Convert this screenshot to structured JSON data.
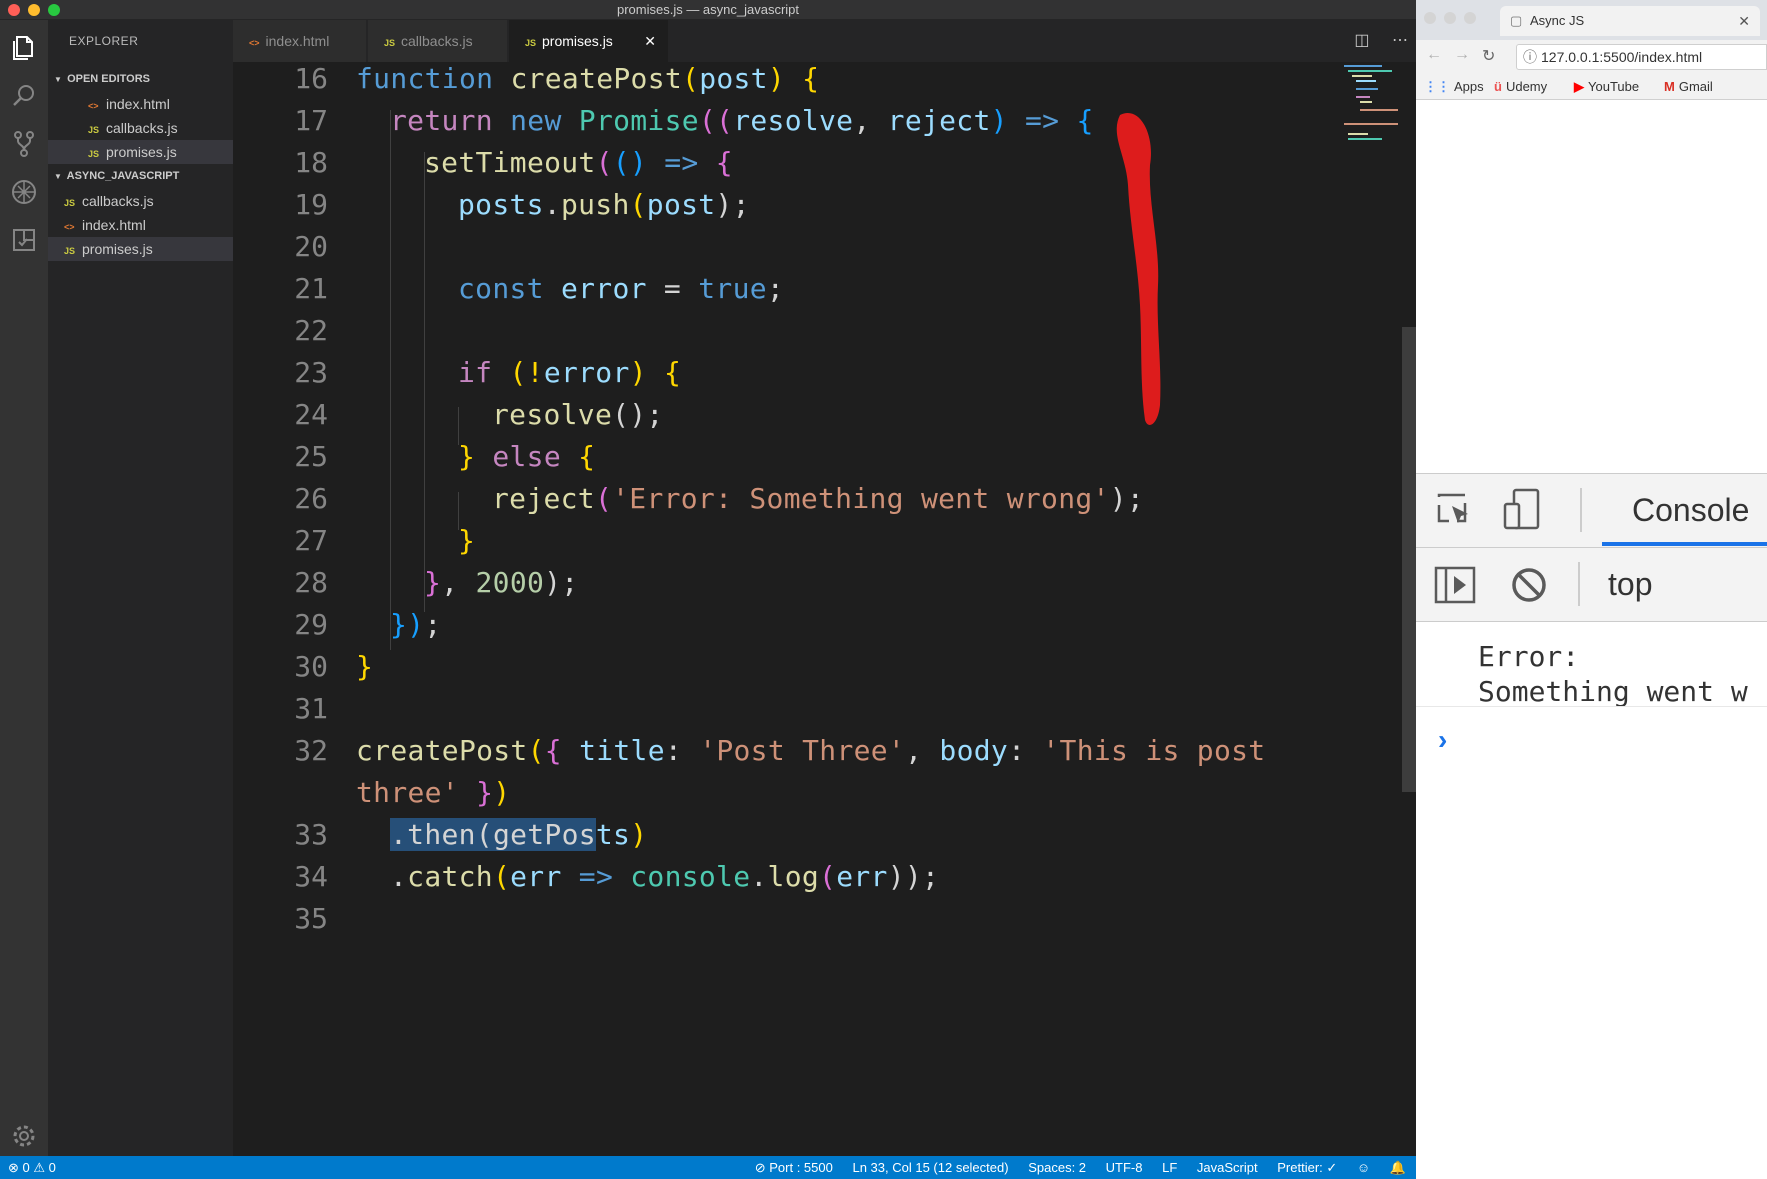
{
  "window_title": "promises.js — async_javascript",
  "sidebar": {
    "title": "EXPLORER",
    "open_editors_label": "OPEN EDITORS",
    "open_editors": [
      {
        "icon": "html",
        "label": "index.html"
      },
      {
        "icon": "js",
        "label": "callbacks.js"
      },
      {
        "icon": "js",
        "label": "promises.js"
      }
    ],
    "folder_label": "ASYNC_JAVASCRIPT",
    "folder_files": [
      {
        "icon": "js",
        "label": "callbacks.js"
      },
      {
        "icon": "html",
        "label": "index.html"
      },
      {
        "icon": "js",
        "label": "promises.js"
      }
    ]
  },
  "tabs": [
    {
      "icon": "html",
      "label": "index.html",
      "active": false
    },
    {
      "icon": "js",
      "label": "callbacks.js",
      "active": false
    },
    {
      "icon": "js",
      "label": "promises.js",
      "active": true
    }
  ],
  "icon_text": {
    "js": "JS",
    "html": "<>",
    "close": "✕"
  },
  "editor": {
    "line_numbers": [
      "16",
      "17",
      "18",
      "19",
      "20",
      "21",
      "22",
      "23",
      "24",
      "25",
      "26",
      "27",
      "28",
      "29",
      "30",
      "31",
      "32",
      "",
      "33",
      "34",
      "35"
    ],
    "code": {
      "l16": {
        "kw": "function",
        "fn": "createPost",
        "p_open": "(",
        "param": "post",
        "p_close": ")",
        "br_open": "{"
      },
      "l17": {
        "ctrl": "return",
        "kw": "new",
        "cls": "Promise",
        "p_open": "((",
        "resolve": "resolve",
        "comma": ", ",
        "reject": "reject",
        "p_close": ")",
        "arrow": "=>",
        "br_open": "{"
      },
      "l18": {
        "fn": "setTimeout",
        "p_open": "(",
        "parens": "()",
        "arrow": "=>",
        "br_open": "{"
      },
      "l19": {
        "var": "posts",
        "dot": ".",
        "fn": "push",
        "p_open": "(",
        "arg": "post",
        "end": ");"
      },
      "l21": {
        "kw": "const",
        "var": "error",
        "eq": " = ",
        "val": "true",
        "semi": ";"
      },
      "l23": {
        "ctrl": "if",
        "cond_open": "(!",
        "var": "error",
        "cond_close": ")",
        "br_open": "{"
      },
      "l24": {
        "fn": "resolve",
        "end": "();"
      },
      "l25": {
        "br_close": "}",
        "ctrl": "else",
        "br_open": "{"
      },
      "l26": {
        "fn": "reject",
        "p_open": "(",
        "str": "'Error: Something went wrong'",
        "end": ");"
      },
      "l27": {
        "br_close": "}"
      },
      "l28": {
        "br_close": "}",
        "comma": ", ",
        "num": "2000",
        "end": ");"
      },
      "l29": {
        "br_close": "})",
        "semi": ";"
      },
      "l30": {
        "br_close": "}"
      },
      "l32": {
        "fn": "createPost",
        "p_open": "(",
        "br_open": "{ ",
        "key1": "title",
        "colon1": ": ",
        "str1": "'Post Three'",
        "comma": ", ",
        "key2": "body",
        "colon2": ": ",
        "str2_a": "'This is post"
      },
      "l32b": {
        "str2_b": "three'",
        "br_close": " }",
        "p_close": ")"
      },
      "l33": {
        "sel": ".then(getPos",
        "rest_fn": "ts",
        "p_close": ")"
      },
      "l34": {
        "dot": ".",
        "fn": "catch",
        "p_open": "(",
        "var": "err",
        "arrow": " => ",
        "cls": "console",
        "dot2": ".",
        "fn2": "log",
        "p2_open": "(",
        "var2": "err",
        "end": "));"
      }
    }
  },
  "statusbar": {
    "problems": "⊗ 0  ⚠ 0",
    "port": "⊘ Port : 5500",
    "position": "Ln 33, Col 15 (12 selected)",
    "spaces": "Spaces: 2",
    "encoding": "UTF-8",
    "eol": "LF",
    "language": "JavaScript",
    "formatter": "Prettier: ✓",
    "feedback": "☺",
    "bell": "🔔"
  },
  "browser": {
    "tab_title": "Async JS",
    "url": "127.0.0.1:5500/index.html",
    "bookmarks": [
      {
        "icon": "apps-icon",
        "label": "Apps",
        "color": "#4285f4"
      },
      {
        "icon": "udemy-icon",
        "label": "Udemy",
        "color": "#ec5252"
      },
      {
        "icon": "youtube-icon",
        "label": "YouTube",
        "color": "#ff0000"
      },
      {
        "icon": "gmail-icon",
        "label": "Gmail",
        "color": "#d93025"
      }
    ],
    "devtools": {
      "active_tab": "Console",
      "context": "top",
      "message_line1": "Error:",
      "message_line2": "Something went w",
      "prompt": "›",
      "accent": "#1a73e8"
    }
  },
  "colors": {
    "editor_bg": "#1e1e1e",
    "statusbar_bg": "#007acc",
    "selection": "#264f78"
  }
}
